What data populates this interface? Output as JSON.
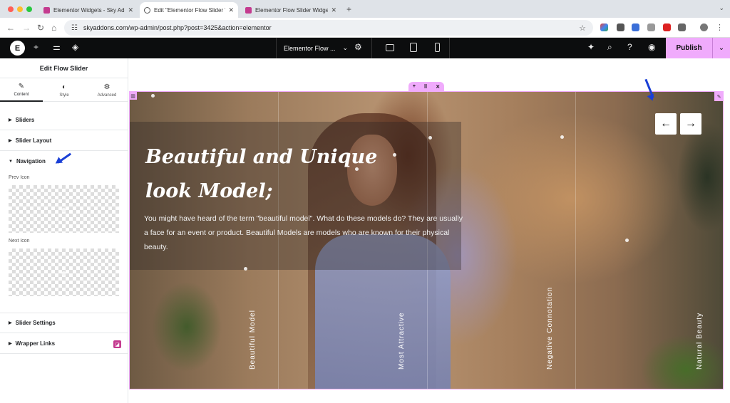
{
  "browser": {
    "tabs": [
      {
        "title": "Elementor Widgets - Sky Addo",
        "close": "✕"
      },
      {
        "title": "Edit \"Elementor Flow Slider W",
        "close": "✕"
      },
      {
        "title": "Elementor Flow Slider Widget",
        "close": "✕"
      }
    ],
    "new_tab": "+",
    "tab_menu": "⌄",
    "url": "skyaddons.com/wp-admin/post.php?post=3425&action=elementor",
    "traffic_colors": [
      "#ff5f57",
      "#febc2e",
      "#28c840"
    ]
  },
  "editor": {
    "logo": "E",
    "doc_title": "Elementor Flow ...",
    "publish": "Publish",
    "accent": "#f0abfc"
  },
  "panel": {
    "title": "Edit Flow Slider",
    "tabs": [
      {
        "label": "Content",
        "icon": "pencil-icon"
      },
      {
        "label": "Style",
        "icon": "contrast-icon"
      },
      {
        "label": "Advanced",
        "icon": "gear-icon"
      }
    ],
    "sections": {
      "sliders": "Sliders",
      "slider_layout": "Slider Layout",
      "navigation": "Navigation",
      "slider_settings": "Slider Settings",
      "wrapper_links": "Wrapper Links"
    },
    "prev_icon_label": "Prev Icon",
    "next_icon_label": "Next Icon"
  },
  "slider": {
    "headline_line1": "Beautiful and Unique",
    "headline_line2": "look Model;",
    "description": "You might have heard of the term \"beautiful model\". What do these models do? They are usually a face for an event or product. Beautiful Models are models who are known for their physical beauty.",
    "labels": [
      "Beautiful Model",
      "Most Attractive",
      "Negative Connotation",
      "Natural Beauty"
    ],
    "prev_arrow": "←",
    "next_arrow": "→"
  }
}
